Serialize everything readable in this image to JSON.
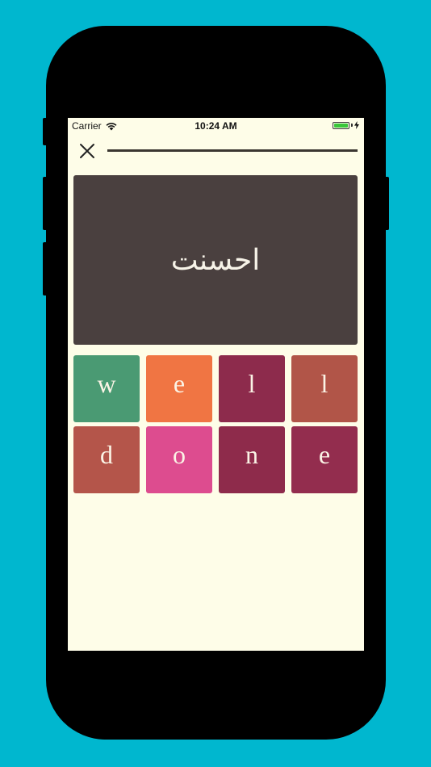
{
  "status_bar": {
    "carrier": "Carrier",
    "time": "10:24 AM",
    "wifi_icon": "wifi-icon",
    "battery_icon": "battery-icon",
    "charging_icon": "bolt-icon",
    "battery_level": 1.0
  },
  "header": {
    "close_icon": "close-icon",
    "progress": 1.0
  },
  "prompt": {
    "word": "احسنت"
  },
  "tiles": [
    {
      "letter": "w",
      "color": "#4a9a73"
    },
    {
      "letter": "e",
      "color": "#f07543"
    },
    {
      "letter": "l",
      "color": "#8d2b4c"
    },
    {
      "letter": "l",
      "color": "#b15548"
    },
    {
      "letter": "d",
      "color": "#b4554a"
    },
    {
      "letter": "o",
      "color": "#dd4c8f"
    },
    {
      "letter": "n",
      "color": "#8e2b4b"
    },
    {
      "letter": "e",
      "color": "#932d4e"
    }
  ],
  "colors": {
    "background": "#00b7cf",
    "screen": "#fefde8",
    "prompt_card": "#4a403f"
  }
}
